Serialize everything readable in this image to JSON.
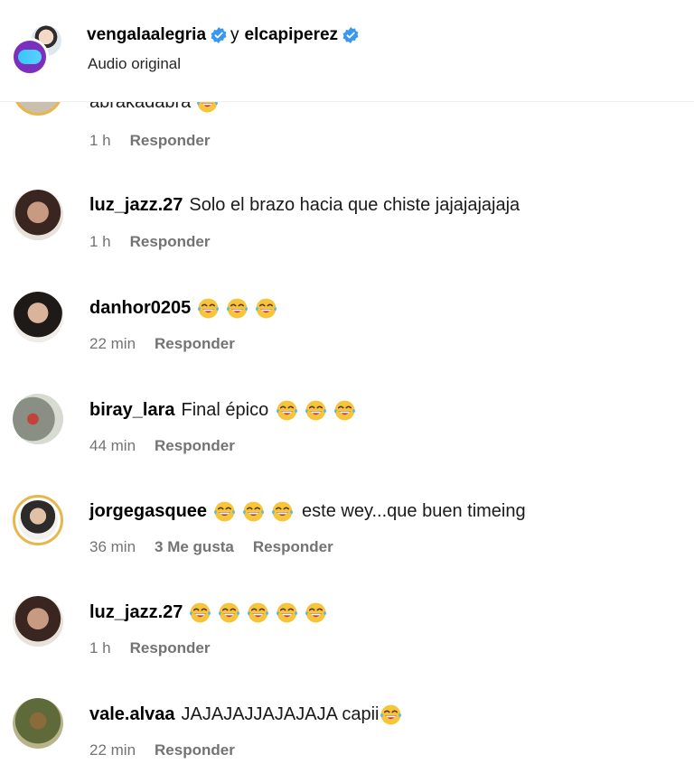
{
  "header": {
    "user1": "vengalaalegria",
    "separator": "y",
    "user2": "elcapiperez",
    "subtitle": "Audio original",
    "verified_color": "#3897f0"
  },
  "comments": [
    {
      "user": "",
      "text": "abrakadabra",
      "emoji_count": 1,
      "time": "1 h",
      "likes": "",
      "reply": "Responder"
    },
    {
      "user": "luz_jazz.27",
      "text": "Solo el brazo hacia que chiste jajajajajaja",
      "emoji_count": 0,
      "time": "1 h",
      "likes": "",
      "reply": "Responder"
    },
    {
      "user": "danhor0205",
      "text": "",
      "emoji_count": 3,
      "time": "22 min",
      "likes": "",
      "reply": "Responder"
    },
    {
      "user": "biray_lara",
      "text": "Final épico",
      "emoji_count": 3,
      "time": "44 min",
      "likes": "",
      "reply": "Responder"
    },
    {
      "user": "jorgegasquee",
      "text": "este wey...que buen timeing",
      "emoji_count": 3,
      "time": "36 min",
      "likes": "3 Me gusta",
      "reply": "Responder"
    },
    {
      "user": "luz_jazz.27",
      "text": "",
      "emoji_count": 5,
      "time": "1 h",
      "likes": "",
      "reply": "Responder"
    },
    {
      "user": "vale.alvaa",
      "text": "JAJAJAJJAJAJAJA capii",
      "emoji_count": 1,
      "time": "22 min",
      "likes": "",
      "reply": "Responder"
    }
  ],
  "icons": {
    "emoji": "face-with-tears-of-joy-icon",
    "verified": "verified-badge-icon"
  },
  "colors": {
    "meta_text": "#737373",
    "story_ring": "#e8b64a"
  }
}
